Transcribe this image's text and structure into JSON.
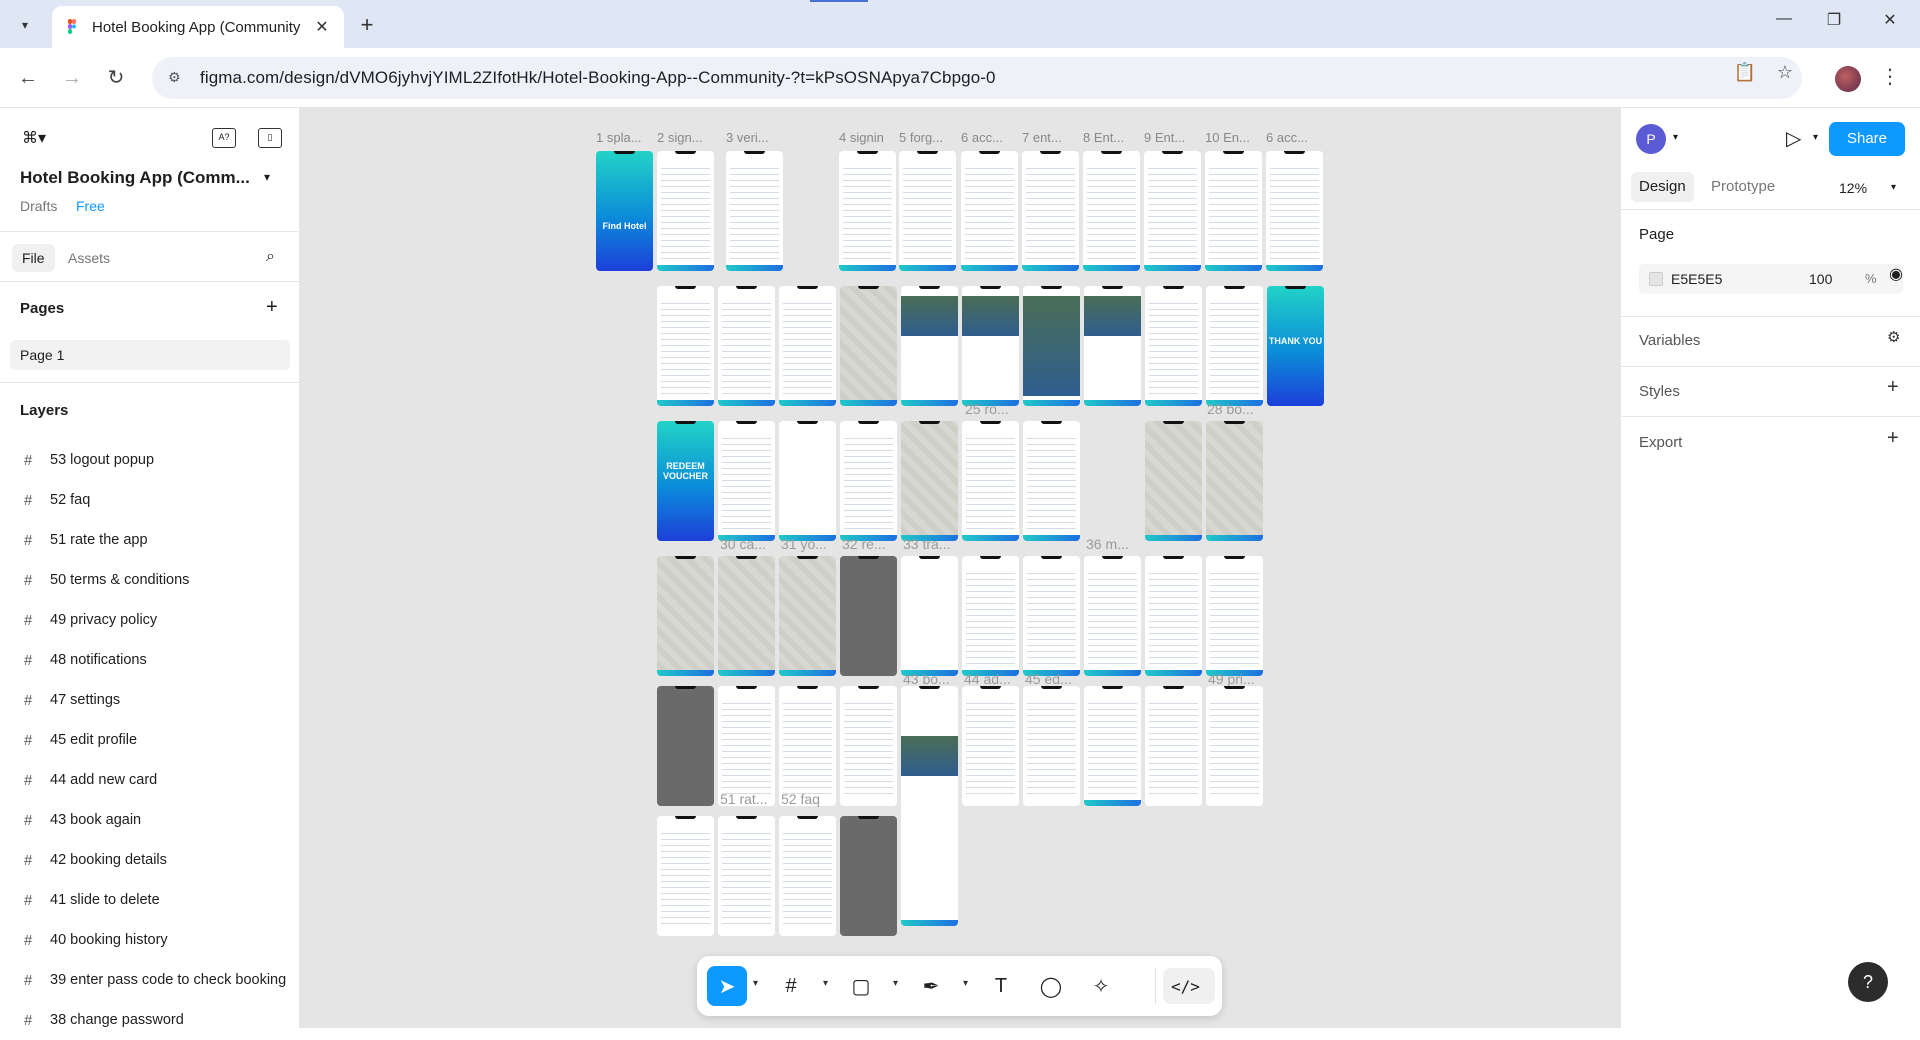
{
  "browser": {
    "tab_title": "Hotel Booking App (Community",
    "url": "figma.com/design/dVMO6jyhvjYIML2ZIfotHk/Hotel-Booking-App--Community-?t=kPsOSNApya7Cbpgo-0"
  },
  "file": {
    "name": "Hotel Booking App (Comm...",
    "drafts": "Drafts",
    "plan": "Free"
  },
  "left_tabs": {
    "file": "File",
    "assets": "Assets"
  },
  "pages": {
    "header": "Pages",
    "items": [
      "Page 1"
    ]
  },
  "layers": {
    "header": "Layers",
    "items": [
      "53 logout popup",
      "52 faq",
      "51 rate the app",
      "50 terms & conditions",
      "49 privacy policy",
      "48 notifications",
      "47 settings",
      "45 edit profile",
      "44 add new card",
      "43 book again",
      "42 booking details",
      "41 slide to delete",
      "40 booking history",
      "39 enter pass code to check booking",
      "38 change password"
    ]
  },
  "canvas": {
    "top_labels": [
      "1 spla...",
      "2 sign...",
      "3 veri...",
      "4 signin",
      "5 forg...",
      "6 acc...",
      "7 ent...",
      "8 Ent...",
      "9 Ent...",
      "10 En...",
      "6 acc..."
    ],
    "captions": {
      "c25": "25 ro...",
      "c28": "28 bo...",
      "c30": "30 ca...",
      "c31": "31 yo...",
      "c32": "32 re...",
      "c33": "33 tra...",
      "c36": "36 m...",
      "c43": "43 bo...",
      "c44": "44 ad...",
      "c45": "45 ed...",
      "c49": "49 pri...",
      "c51": "51 rat...",
      "c52": "52 faq"
    },
    "splash_text": "Find Hotel",
    "thankyou_text": "THANK YOU",
    "redeem_text": "REDEEM VOUCHER"
  },
  "right_panel": {
    "avatar_letter": "P",
    "share": "Share",
    "tabs": {
      "design": "Design",
      "prototype": "Prototype"
    },
    "zoom": "12%",
    "page_section": "Page",
    "page_color": "E5E5E5",
    "opacity": "100",
    "pct": "%",
    "variables": "Variables",
    "styles": "Styles",
    "export": "Export"
  },
  "help": "?"
}
